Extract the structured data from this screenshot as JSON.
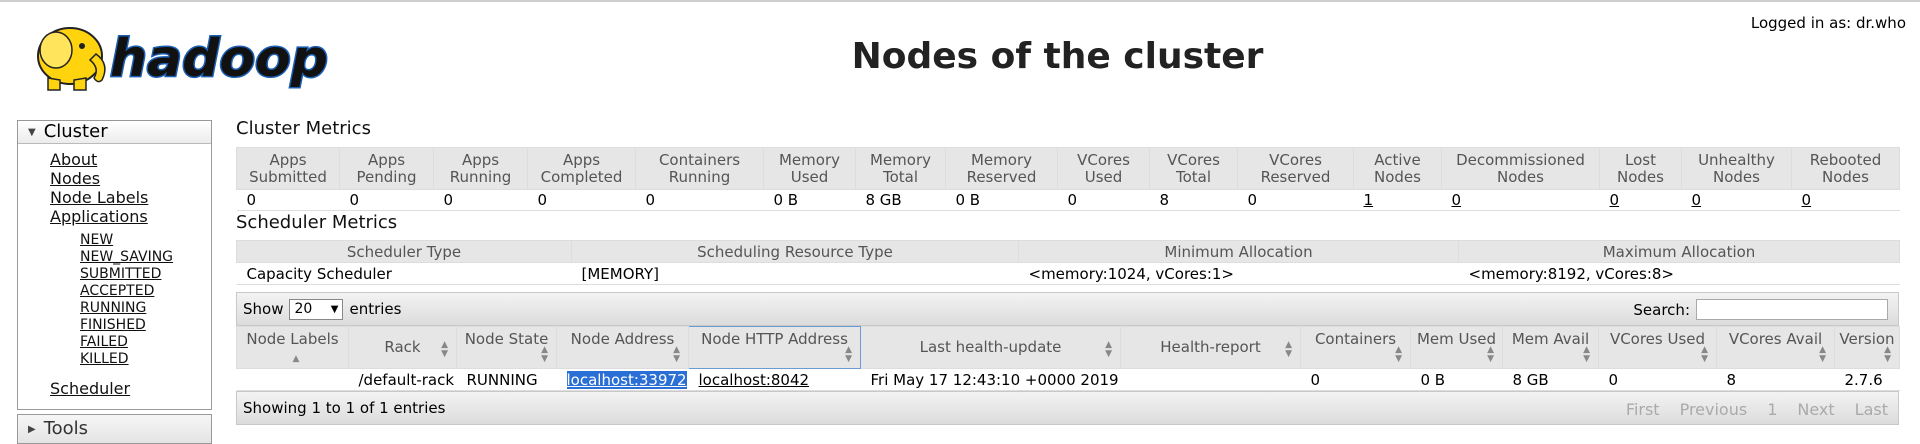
{
  "header": {
    "logo_text": "hadoop",
    "title": "Nodes of the cluster",
    "logged_in": "Logged in as: dr.who"
  },
  "sidebar": {
    "cluster_label": "Cluster",
    "items": [
      "About",
      "Nodes",
      "Node Labels",
      "Applications"
    ],
    "app_states": [
      "NEW",
      "NEW_SAVING",
      "SUBMITTED",
      "ACCEPTED",
      "RUNNING",
      "FINISHED",
      "FAILED",
      "KILLED"
    ],
    "scheduler_label": "Scheduler",
    "tools_label": "Tools"
  },
  "cluster_metrics": {
    "title": "Cluster Metrics",
    "headers": [
      [
        "Apps",
        "Submitted"
      ],
      [
        "Apps",
        "Pending"
      ],
      [
        "Apps",
        "Running"
      ],
      [
        "Apps",
        "Completed"
      ],
      [
        "Containers",
        "Running"
      ],
      [
        "Memory",
        "Used"
      ],
      [
        "Memory",
        "Total"
      ],
      [
        "Memory",
        "Reserved"
      ],
      [
        "VCores",
        "Used"
      ],
      [
        "VCores",
        "Total"
      ],
      [
        "VCores",
        "Reserved"
      ],
      [
        "Active",
        "Nodes"
      ],
      [
        "Decommissioned",
        "Nodes"
      ],
      [
        "Lost",
        "Nodes"
      ],
      [
        "Unhealthy",
        "Nodes"
      ],
      [
        "Rebooted",
        "Nodes"
      ]
    ],
    "values": [
      "0",
      "0",
      "0",
      "0",
      "0",
      "0 B",
      "8 GB",
      "0 B",
      "0",
      "8",
      "0",
      "1",
      "0",
      "0",
      "0",
      "0"
    ]
  },
  "scheduler_metrics": {
    "title": "Scheduler Metrics",
    "headers": [
      "Scheduler Type",
      "Scheduling Resource Type",
      "Minimum Allocation",
      "Maximum Allocation"
    ],
    "values": [
      "Capacity Scheduler",
      "[MEMORY]",
      "<memory:1024, vCores:1>",
      "<memory:8192, vCores:8>"
    ]
  },
  "nodes_table": {
    "show_label": "Show",
    "page_length": "20",
    "entries_label": "entries",
    "search_label": "Search:",
    "search_value": "",
    "headers": [
      "Node Labels",
      "Rack",
      "Node State",
      "Node Address",
      "Node HTTP Address",
      "Last health-update",
      "Health-report",
      "Containers",
      "Mem Used",
      "Mem Avail",
      "VCores Used",
      "VCores Avail",
      "Version"
    ],
    "rows": [
      [
        "",
        "/default-rack",
        "RUNNING",
        "localhost:33972",
        "localhost:8042",
        "Fri May 17 12:43:10 +0000 2019",
        "",
        "0",
        "0 B",
        "8 GB",
        "0",
        "8",
        "2.7.6"
      ]
    ],
    "info": "Showing 1 to 1 of 1 entries",
    "pager": [
      "First",
      "Previous",
      "1",
      "Next",
      "Last"
    ]
  },
  "colors": {
    "selection": "#2a6fd6",
    "header_bg": "#e6e6e6",
    "logo_yellow": "#ffd40f"
  }
}
